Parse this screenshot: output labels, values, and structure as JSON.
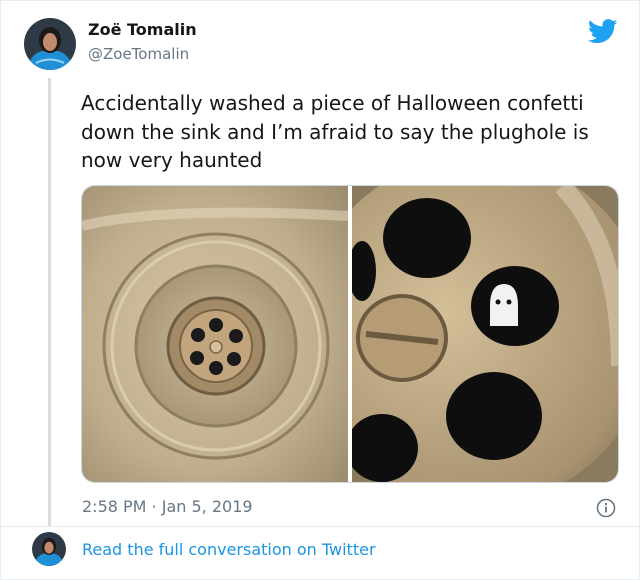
{
  "tweet": {
    "author_name": "Zoë Tomalin",
    "author_handle": "@ZoeTomalin",
    "text": "Accidentally washed a piece of Halloween confetti down the sink and I’m afraid to say the plughole is now very haunted",
    "timestamp": "2:58 PM · Jan 5, 2019",
    "footer_link": "Read the full conversation on Twitter"
  },
  "icons": {
    "brand": "twitter-bird-icon",
    "info": "info-icon"
  },
  "colors": {
    "twitter_blue": "#1da1f2",
    "link_blue": "#1b95e0",
    "secondary_text": "#657786",
    "primary_text": "#14171a",
    "avatar_blue": "#1f8fd6"
  }
}
